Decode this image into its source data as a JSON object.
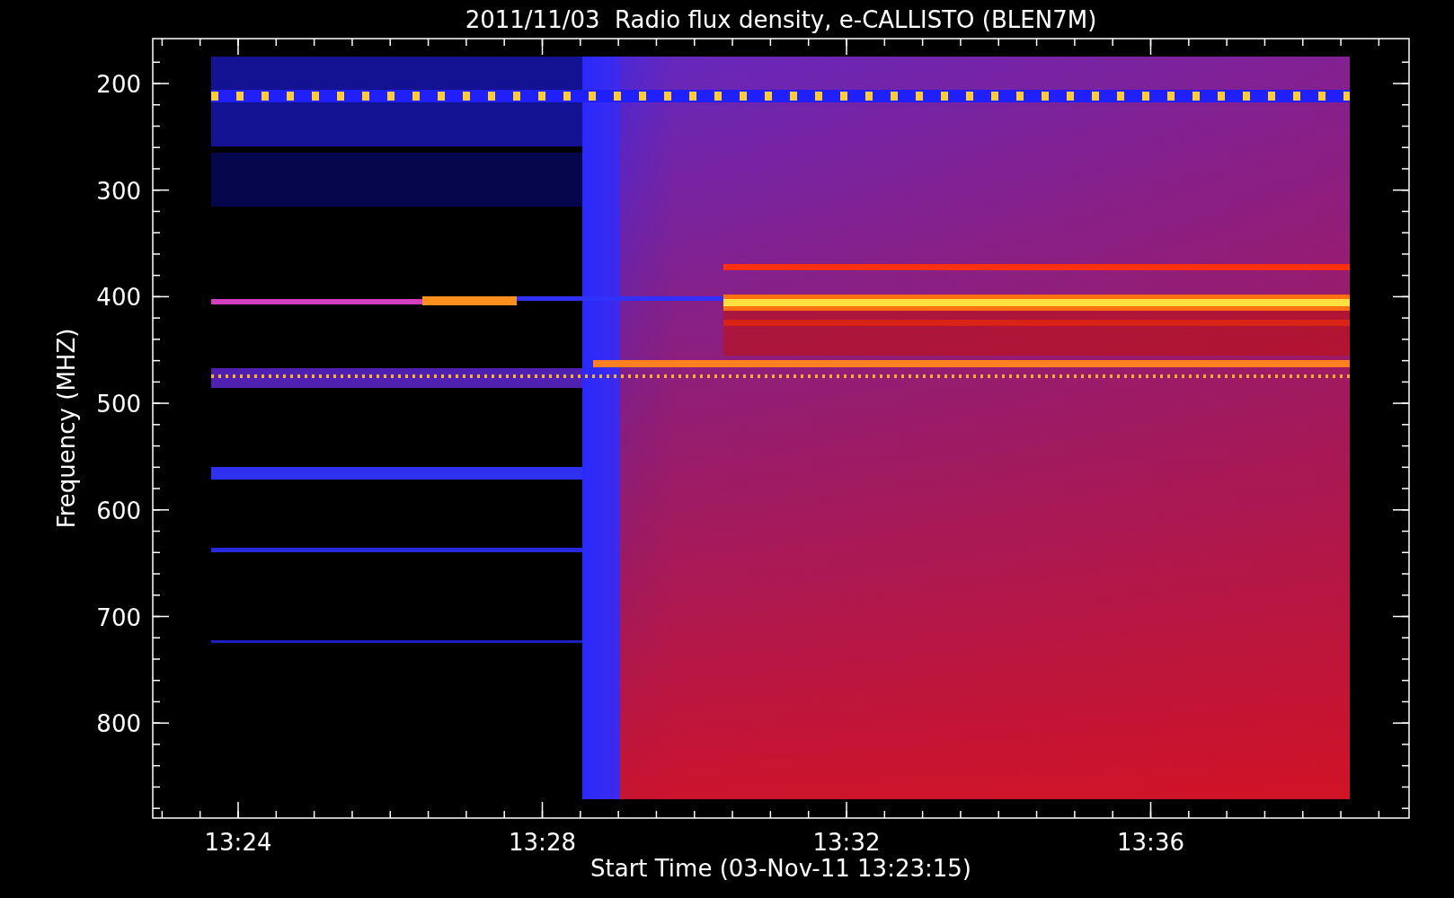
{
  "title": "2011/11/03  Radio flux density, e-CALLISTO (BLEN7M)",
  "y_axis": {
    "label": "Frequency (MHZ)",
    "ticks": [
      "200",
      "300",
      "400",
      "500",
      "600",
      "700",
      "800"
    ]
  },
  "x_axis": {
    "label": "Start Time (03-Nov-11 13:23:15)",
    "ticks": [
      "13:24",
      "13:28",
      "13:32",
      "13:36"
    ]
  }
}
